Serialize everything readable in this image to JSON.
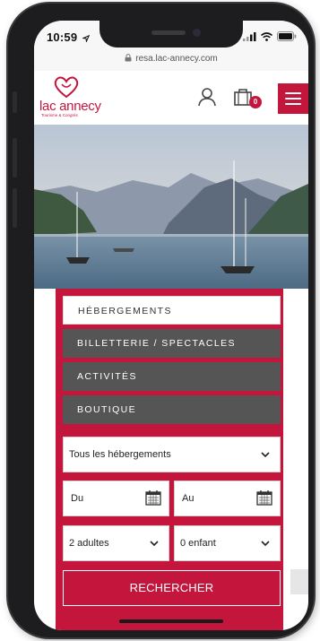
{
  "statusbar": {
    "time": "10:59",
    "location_icon": "location-arrow-icon",
    "signal_icon": "cellular-signal-icon",
    "wifi_icon": "wifi-icon",
    "battery_icon": "battery-icon"
  },
  "browser": {
    "url": "resa.lac-annecy.com",
    "lock_icon": "lock-icon"
  },
  "header": {
    "logo_text": "lac annecy",
    "logo_sub": "Tourisme & Congrès",
    "user_icon": "user-icon",
    "cart_icon": "shopping-bag-icon",
    "cart_count": "0",
    "menu_icon": "hamburger-menu-icon"
  },
  "colors": {
    "brand": "#c4163d",
    "tab_inactive": "#555555",
    "tab_active": "#ffffff"
  },
  "booking": {
    "tabs": [
      {
        "label": "HÉBERGEMENTS",
        "active": true
      },
      {
        "label": "BILLETTERIE / SPECTACLES",
        "active": false
      },
      {
        "label": "ACTIVITÉS",
        "active": false
      },
      {
        "label": "BOUTIQUE",
        "active": false
      }
    ],
    "type_select": "Tous les hébergements",
    "date_from": "Du",
    "date_to": "Au",
    "adults_select": "2 adultes",
    "children_select": "0 enfant",
    "search_label": "RECHERCHER"
  }
}
